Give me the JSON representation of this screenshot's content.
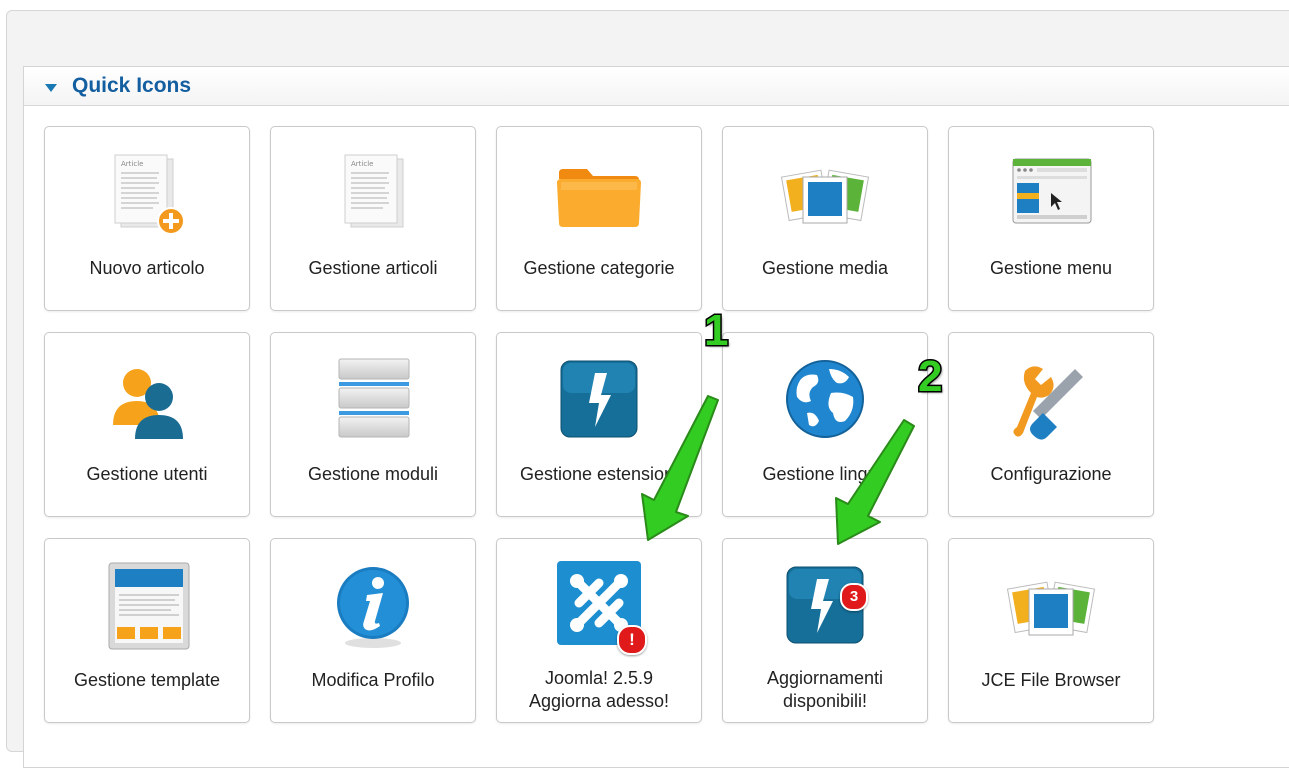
{
  "panel": {
    "title": "Quick Icons"
  },
  "tiles": [
    {
      "label": "Nuovo articolo",
      "icon": "new-article-icon"
    },
    {
      "label": "Gestione articoli",
      "icon": "articles-icon"
    },
    {
      "label": "Gestione categorie",
      "icon": "folder-icon"
    },
    {
      "label": "Gestione media",
      "icon": "media-icon"
    },
    {
      "label": "Gestione menu",
      "icon": "menu-icon"
    },
    {
      "label": "Gestione utenti",
      "icon": "users-icon"
    },
    {
      "label": "Gestione moduli",
      "icon": "modules-icon"
    },
    {
      "label": "Gestione estensioni",
      "icon": "extensions-icon"
    },
    {
      "label": "Gestione lingua",
      "icon": "globe-icon"
    },
    {
      "label": "Configurazione",
      "icon": "wrench-screwdriver-icon"
    },
    {
      "label": "Gestione template",
      "icon": "template-icon"
    },
    {
      "label": "Modifica Profilo",
      "icon": "info-icon"
    },
    {
      "label_line1": "Joomla! 2.5.9",
      "label_line2": "Aggiorna adesso!",
      "icon": "joomla-update-icon",
      "badge": "!"
    },
    {
      "label_line1": "Aggiornamenti",
      "label_line2": "disponibili!",
      "icon": "extension-updates-icon",
      "badge": "3"
    },
    {
      "label": "JCE File Browser",
      "icon": "file-browser-icon"
    }
  ],
  "annotations": {
    "one": "1",
    "two": "2"
  },
  "colors": {
    "accent": "#135fa0",
    "annotation": "#33cc22"
  }
}
